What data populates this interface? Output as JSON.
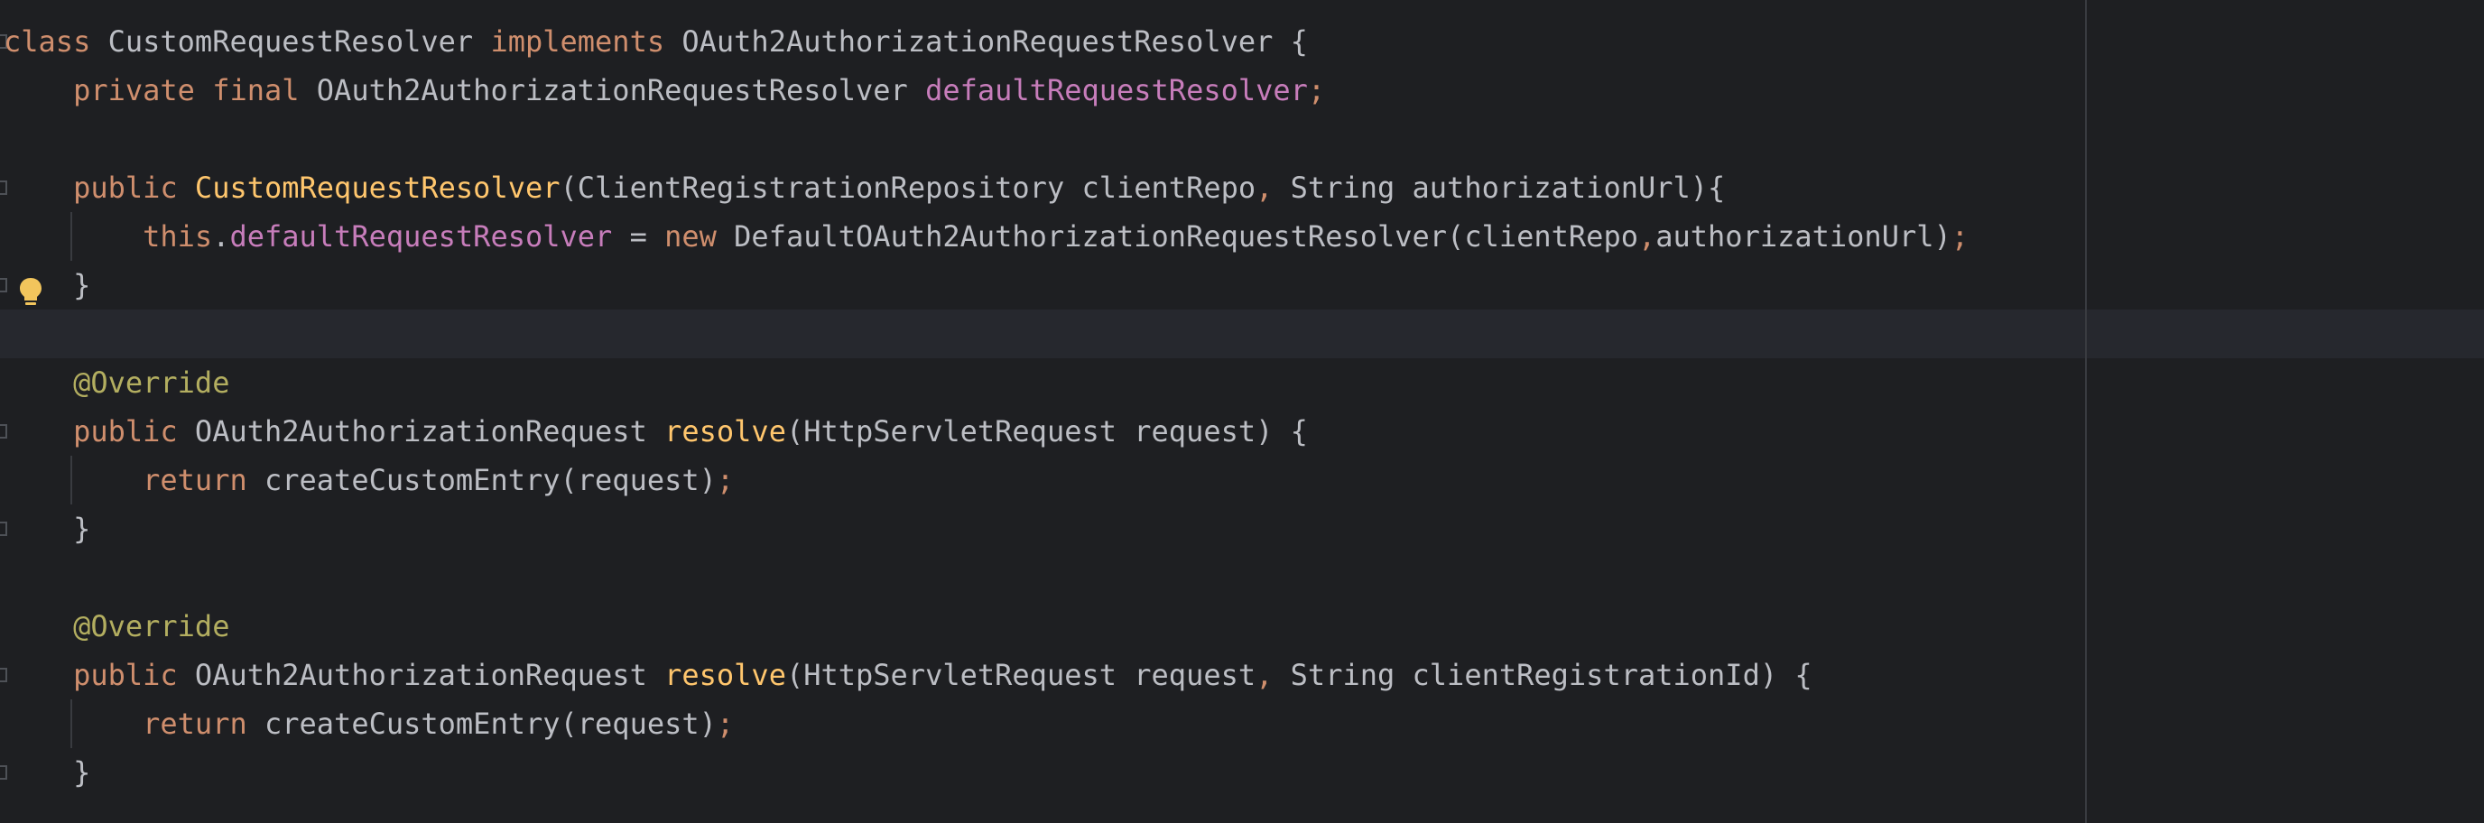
{
  "editor": {
    "lines": [
      {
        "tokens": [
          {
            "text": "class",
            "cls": "kw"
          },
          {
            "text": " CustomRequestResolver ",
            "cls": "plain"
          },
          {
            "text": "implements",
            "cls": "kw"
          },
          {
            "text": " OAuth2AuthorizationRequestResolver {",
            "cls": "plain"
          }
        ]
      },
      {
        "tokens": [
          {
            "text": "    ",
            "cls": "plain"
          },
          {
            "text": "private final",
            "cls": "kw"
          },
          {
            "text": " OAuth2AuthorizationRequestResolver ",
            "cls": "plain"
          },
          {
            "text": "defaultRequestResolver",
            "cls": "field"
          },
          {
            "text": ";",
            "cls": "kw"
          }
        ]
      },
      {
        "tokens": []
      },
      {
        "tokens": [
          {
            "text": "    ",
            "cls": "plain"
          },
          {
            "text": "public",
            "cls": "kw"
          },
          {
            "text": " ",
            "cls": "plain"
          },
          {
            "text": "CustomRequestResolver",
            "cls": "fn"
          },
          {
            "text": "(ClientRegistrationRepository clientRepo",
            "cls": "plain"
          },
          {
            "text": ",",
            "cls": "kw"
          },
          {
            "text": " String authorizationUrl){",
            "cls": "plain"
          }
        ]
      },
      {
        "tokens": [
          {
            "text": "        ",
            "cls": "plain"
          },
          {
            "text": "this",
            "cls": "kw"
          },
          {
            "text": ".",
            "cls": "plain"
          },
          {
            "text": "defaultRequestResolver",
            "cls": "field"
          },
          {
            "text": " = ",
            "cls": "plain"
          },
          {
            "text": "new",
            "cls": "kw"
          },
          {
            "text": " DefaultOAuth2AuthorizationRequestResolver(clientRepo",
            "cls": "plain"
          },
          {
            "text": ",",
            "cls": "kw"
          },
          {
            "text": "authorizationUrl)",
            "cls": "plain"
          },
          {
            "text": ";",
            "cls": "kw"
          }
        ]
      },
      {
        "tokens": [
          {
            "text": "    }",
            "cls": "plain"
          }
        ]
      },
      {
        "tokens": []
      },
      {
        "tokens": [
          {
            "text": "    ",
            "cls": "plain"
          },
          {
            "text": "@Override",
            "cls": "anno"
          }
        ]
      },
      {
        "tokens": [
          {
            "text": "    ",
            "cls": "plain"
          },
          {
            "text": "public",
            "cls": "kw"
          },
          {
            "text": " OAuth2AuthorizationRequest ",
            "cls": "plain"
          },
          {
            "text": "resolve",
            "cls": "fn"
          },
          {
            "text": "(HttpServletRequest request) {",
            "cls": "plain"
          }
        ]
      },
      {
        "tokens": [
          {
            "text": "        ",
            "cls": "plain"
          },
          {
            "text": "return",
            "cls": "kw"
          },
          {
            "text": " createCustomEntry(request)",
            "cls": "plain"
          },
          {
            "text": ";",
            "cls": "kw"
          }
        ]
      },
      {
        "tokens": [
          {
            "text": "    }",
            "cls": "plain"
          }
        ]
      },
      {
        "tokens": []
      },
      {
        "tokens": [
          {
            "text": "    ",
            "cls": "plain"
          },
          {
            "text": "@Override",
            "cls": "anno"
          }
        ]
      },
      {
        "tokens": [
          {
            "text": "    ",
            "cls": "plain"
          },
          {
            "text": "public",
            "cls": "kw"
          },
          {
            "text": " OAuth2AuthorizationRequest ",
            "cls": "plain"
          },
          {
            "text": "resolve",
            "cls": "fn"
          },
          {
            "text": "(HttpServletRequest request",
            "cls": "plain"
          },
          {
            "text": ",",
            "cls": "kw"
          },
          {
            "text": " String clientRegistrationId) {",
            "cls": "plain"
          }
        ]
      },
      {
        "tokens": [
          {
            "text": "        ",
            "cls": "plain"
          },
          {
            "text": "return",
            "cls": "kw"
          },
          {
            "text": " createCustomEntry(request)",
            "cls": "plain"
          },
          {
            "text": ";",
            "cls": "kw"
          }
        ]
      },
      {
        "tokens": [
          {
            "text": "    }",
            "cls": "plain"
          }
        ]
      }
    ]
  },
  "colors": {
    "background": "#1e1f22",
    "keyword": "#cf8e6d",
    "field": "#c77dbb",
    "method": "#ffc66d",
    "annotation": "#b3ae60",
    "text": "#bcbec4",
    "bulb": "#f2c55c"
  },
  "icons": {
    "gutter_intention": "bulb-icon",
    "fold": "fold-marker-icon"
  }
}
